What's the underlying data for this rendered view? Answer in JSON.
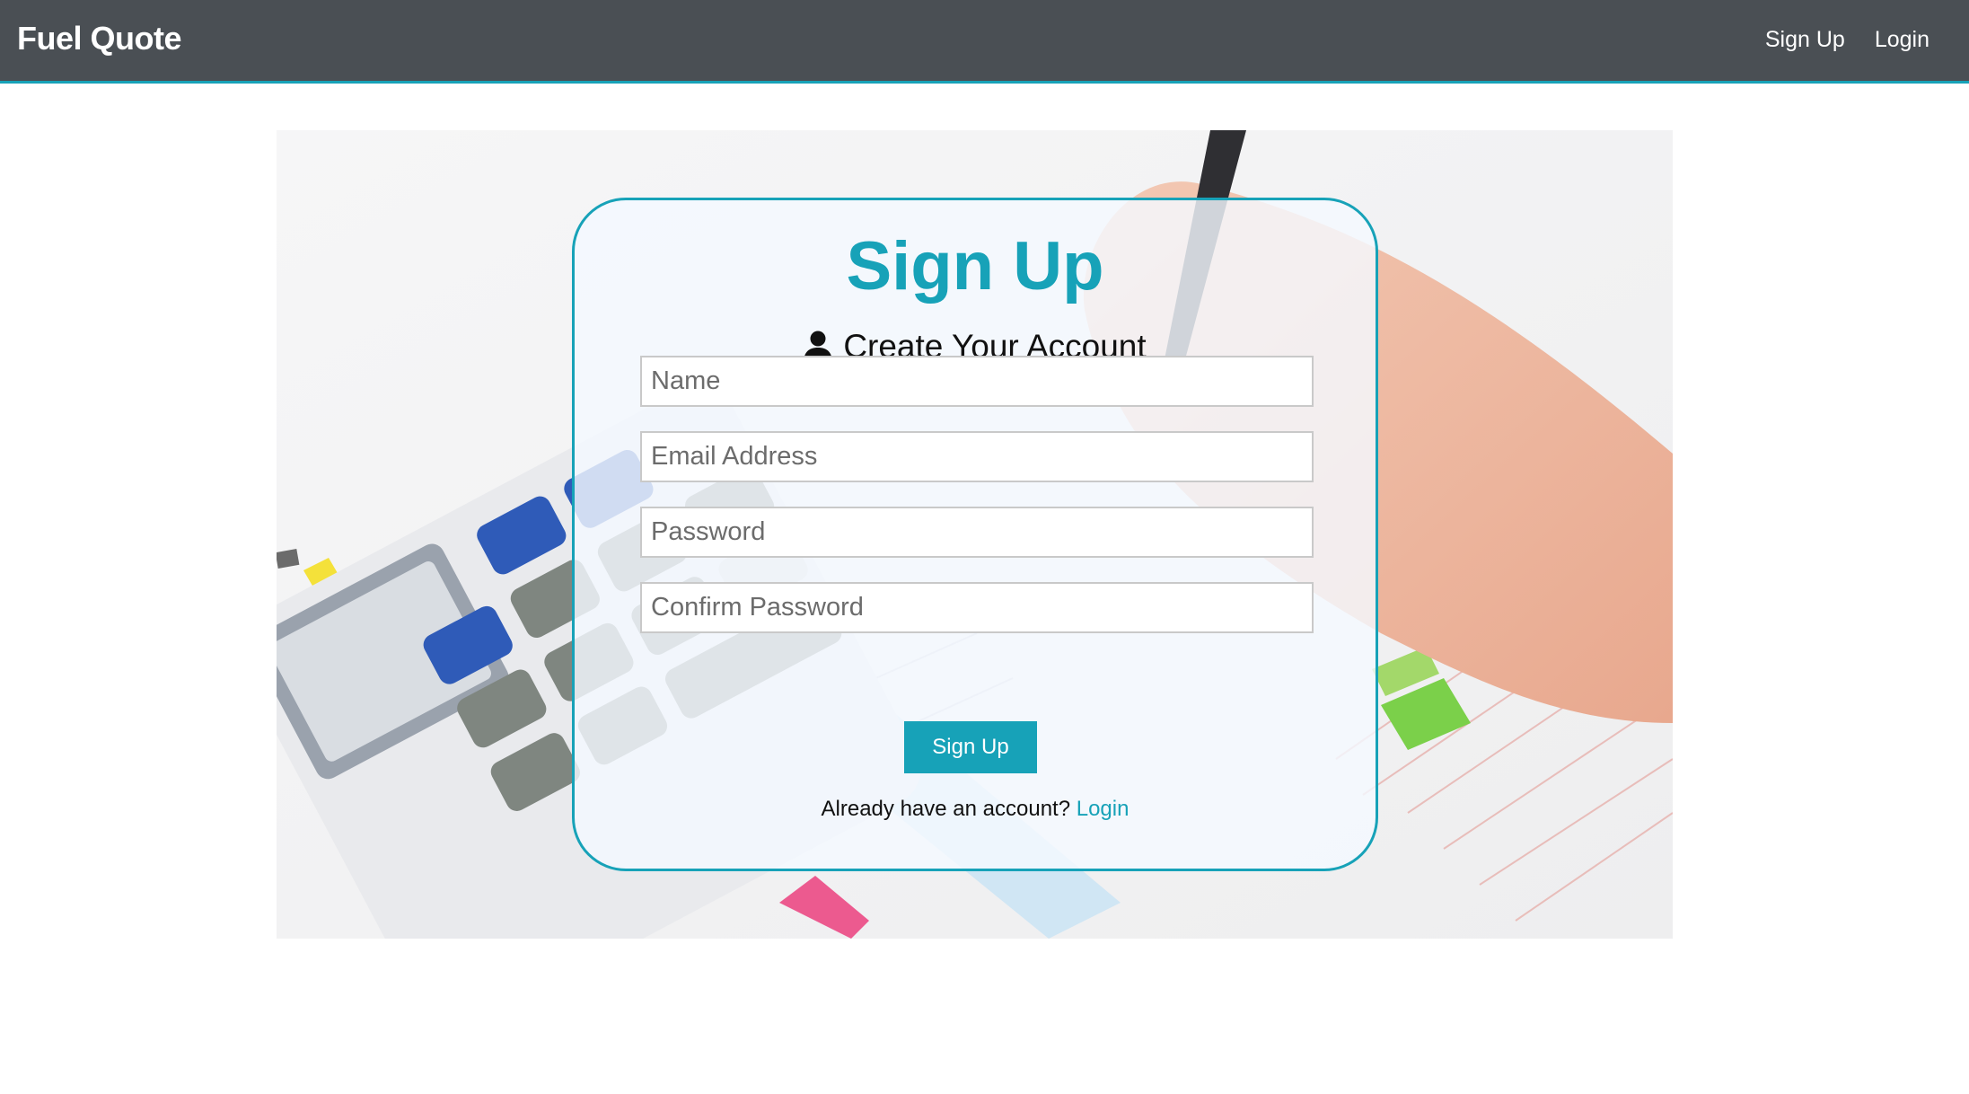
{
  "navbar": {
    "brand": "Fuel Quote",
    "links": [
      {
        "label": "Sign Up"
      },
      {
        "label": "Login"
      }
    ],
    "accent_color": "#17a2b8",
    "background_color": "#4a4f54"
  },
  "form": {
    "title": "Sign Up",
    "subtitle": "Create Your Account",
    "subtitle_icon": "user-icon",
    "fields": [
      {
        "placeholder": "Name",
        "value": ""
      },
      {
        "placeholder": "Email Address",
        "value": ""
      },
      {
        "placeholder": "Password",
        "value": ""
      },
      {
        "placeholder": "Confirm Password",
        "value": ""
      }
    ],
    "submit_label": "Sign Up",
    "login_prompt": "Already have an account?",
    "login_link": "Login"
  },
  "hero": {
    "background_image": "calculator-and-tax-form-photo"
  }
}
